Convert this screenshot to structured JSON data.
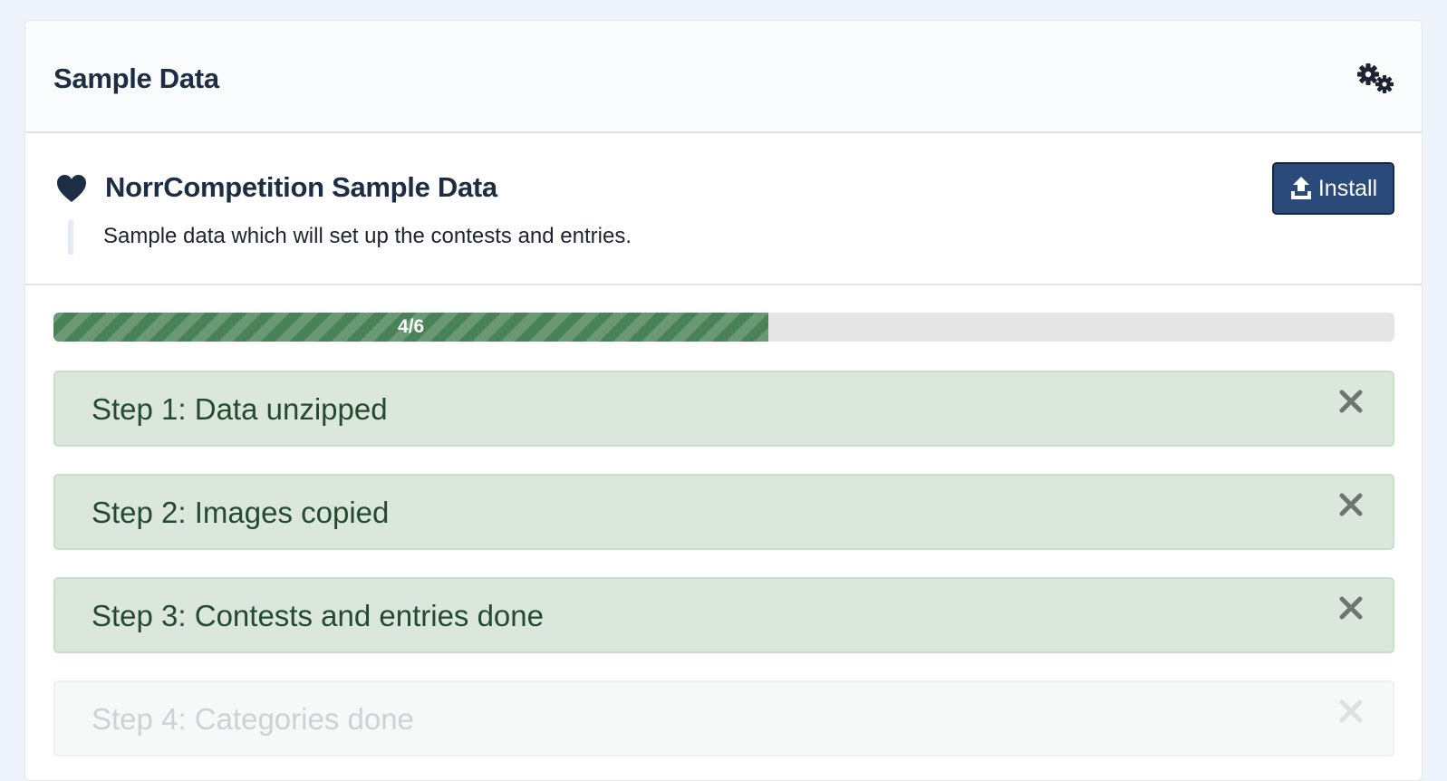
{
  "header": {
    "title": "Sample Data",
    "settings_icon": "gears-icon"
  },
  "sample": {
    "icon": "heart-icon",
    "title": "NorrCompetition Sample Data",
    "description": "Sample data which will set up the contests and entries.",
    "install_label": "Install",
    "install_icon": "upload-icon"
  },
  "progress": {
    "label": "4/6",
    "current": 4,
    "total": 6,
    "fraction": 0.5333
  },
  "steps": [
    {
      "label": "Step 1: Data unzipped",
      "state": "done"
    },
    {
      "label": "Step 2: Images copied",
      "state": "done"
    },
    {
      "label": "Step 3: Contests and entries done",
      "state": "done"
    },
    {
      "label": "Step 4: Categories done",
      "state": "appearing"
    }
  ],
  "colors": {
    "brand": "#2a4a7a",
    "success_bg": "#dbe7dc",
    "success_text": "#244a2f",
    "progress": "#4a8257"
  }
}
